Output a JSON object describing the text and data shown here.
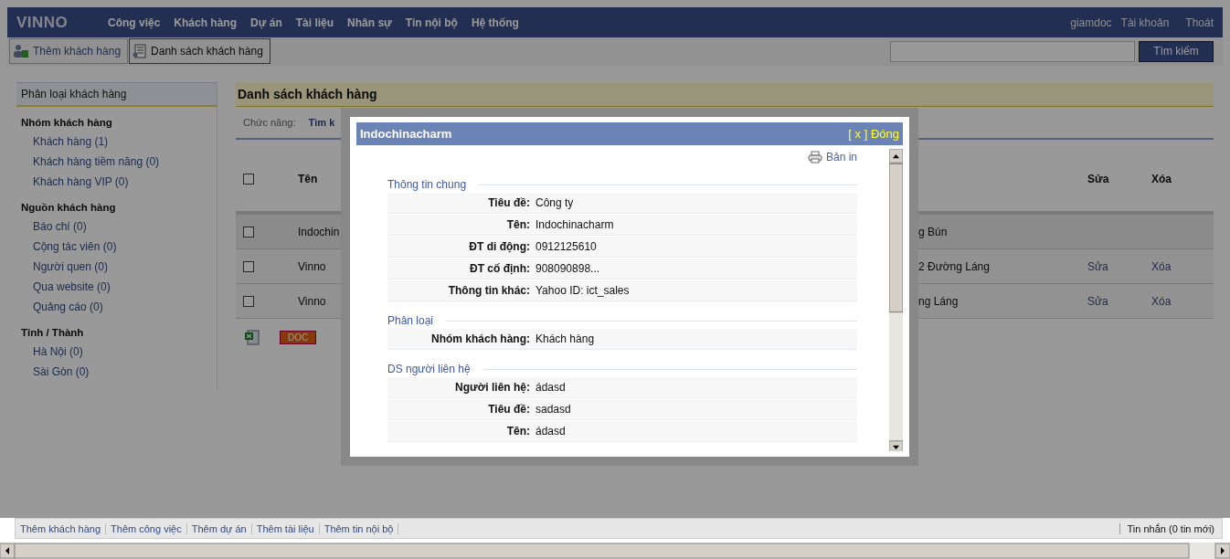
{
  "nav": {
    "logo": "VINNO",
    "menu": [
      "Công việc",
      "Khách hàng",
      "Dự án",
      "Tài liệu",
      "Nhân sự",
      "Tin nội bộ",
      "Hệ thống"
    ],
    "user": [
      "giamdoc",
      "Tài khoản",
      "Thoát"
    ]
  },
  "toolbar": {
    "buttons": [
      {
        "label": "Thêm khách hàng",
        "kind": "add",
        "selected": false
      },
      {
        "label": "Danh sách khách hàng",
        "kind": "list",
        "selected": true
      }
    ],
    "search": {
      "button": "Tìm kiếm"
    }
  },
  "sidebar": {
    "title": "Phân loại khách hàng",
    "groups": [
      {
        "title": "Nhóm khách hàng",
        "items": [
          "Khách hàng (1)",
          "Khách hàng tiềm năng (0)",
          "Khách hàng VIP (0)"
        ]
      },
      {
        "title": "Nguồn khách hàng",
        "items": [
          "Báo chí (0)",
          "Cộng tác viên (0)",
          "Người quen (0)",
          "Qua website (0)",
          "Quảng cáo (0)"
        ]
      },
      {
        "title": "Tỉnh / Thành",
        "items": [
          "Hà Nội (0)",
          "Sài Gòn (0)"
        ]
      }
    ]
  },
  "main": {
    "title": "Danh sách khách hàng",
    "function_label": "Chức năng:",
    "function_link": "Tìm k",
    "header_checked": false,
    "columns": [
      "Tên",
      "Sửa",
      "Xóa"
    ],
    "rows": [
      {
        "checked": false,
        "name": "Indochin",
        "address": "g Bún"
      },
      {
        "checked": false,
        "name": "Vinno",
        "address": "2 Đường Láng",
        "edit": "Sửa",
        "delete": "Xóa"
      },
      {
        "checked": false,
        "name": "Vinno",
        "address": "ng Láng",
        "edit": "Sửa",
        "delete": "Xóa"
      }
    ],
    "export": {
      "doc": "DOC"
    }
  },
  "modal": {
    "title": "Indochinacharm",
    "close": "[ x ] Đóng",
    "print": "Bản in",
    "sections": [
      {
        "title": "Thông tin chung",
        "fields": [
          {
            "label": "Tiêu đề:",
            "value": "Công ty"
          },
          {
            "label": "Tên:",
            "value": "Indochinacharm"
          },
          {
            "label": "ĐT di động:",
            "value": "0912125610"
          },
          {
            "label": "ĐT cố định:",
            "value": "908090898..."
          },
          {
            "label": "Thông tin khác:",
            "value": "Yahoo ID: ict_sales"
          }
        ]
      },
      {
        "title": "Phân loại",
        "fields": [
          {
            "label": "Nhóm khách hàng:",
            "value": "Khách hàng"
          }
        ]
      },
      {
        "title": "DS người liên hệ",
        "fields": [
          {
            "label": "Người liên hệ:",
            "value": "ádasd"
          },
          {
            "label": "Tiêu đề:",
            "value": "sadasd"
          },
          {
            "label": "Tên:",
            "value": "ádasd"
          }
        ]
      }
    ]
  },
  "footer": {
    "links": [
      "Thêm khách hàng",
      "Thêm công việc",
      "Thêm dự án",
      "Thêm tài liệu",
      "Thêm tin nội bộ"
    ],
    "messages": "Tin nhắn (0 tin mới)"
  }
}
